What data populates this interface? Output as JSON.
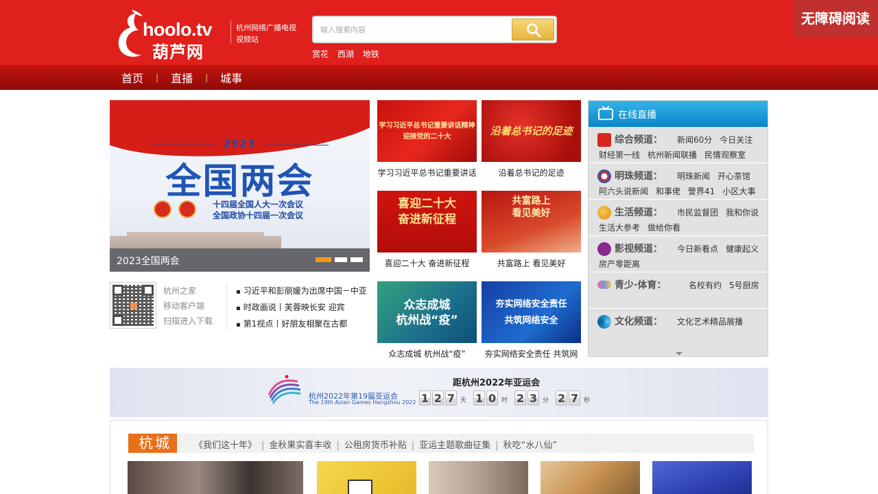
{
  "header": {
    "logo_main": "hoolo.tv",
    "logo_cn": "葫芦网",
    "logo_sub": "杭州网络广播电视视频站",
    "search_placeholder": "输入搜索内容",
    "hotwords": [
      "赏花",
      "西湖",
      "地铁"
    ],
    "accessibility_label": "无障碍阅读"
  },
  "nav": {
    "items": [
      "首页",
      "直播",
      "城事"
    ]
  },
  "slider": {
    "year": "2023",
    "title": "全国两会",
    "sub1": "十四届全国人大一次会议",
    "sub2": "全国政协十四届一次会议",
    "caption": "2023全国两会",
    "active_dot": 1,
    "dot_count": 3
  },
  "client": {
    "lines": [
      "杭州之家",
      "移动客户端",
      "扫描进入下载"
    ]
  },
  "news_list": [
    "习近平和彭丽媛为出席中国－中亚",
    "时政画说丨芙蓉映长安 迎宾",
    "第1视点丨好朋友相聚在古都"
  ],
  "thumbs": [
    {
      "caption": "学习习近平总书记重要讲话",
      "overlay": "学习习近平总书记重要讲话精神\n迎接党的二十大"
    },
    {
      "caption": "沿着总书记的足迹",
      "overlay": "沿着总书记的足迹"
    },
    {
      "caption": "喜迎二十大 奋进新征程",
      "overlay": "喜迎二十大\n奋进新征程"
    },
    {
      "caption": "共富路上 看见美好",
      "overlay": "共富路上\n看见美好"
    },
    {
      "caption": "众志成城 杭州战“疫”",
      "overlay": "众志成城\n杭州战“疫”"
    },
    {
      "caption": "夯实网络安全责任 共筑网",
      "overlay": "夯实网络安全责任\n共筑网络安全"
    }
  ],
  "live": {
    "title": "在线直播",
    "channels": [
      {
        "name": "综合频道：",
        "row1": [
          "新闻60分",
          "今日关注"
        ],
        "row2": [
          "财经第一线",
          "杭州新闻联播",
          "民情观察室"
        ],
        "color": "#d8261f"
      },
      {
        "name": "明珠频道：",
        "row1": [
          "明珠新闻",
          "开心茶馆"
        ],
        "row2": [
          "阿六头说新闻",
          "和事佬",
          "警界41",
          "小区大事"
        ],
        "color": "#1a63b8"
      },
      {
        "name": "生活频道：",
        "row1": [
          "市民监督团",
          "我和你说"
        ],
        "row2": [
          "生活大参考",
          "做给你看"
        ],
        "color": "#e9a21e"
      },
      {
        "name": "影视频道：",
        "row1": [
          "今日新看点",
          "健康起义"
        ],
        "row2": [
          "房产零距离"
        ],
        "color": "#8a2a8f"
      },
      {
        "name": "青少·体育：",
        "row1": [
          "名校有约",
          "5号厨房"
        ],
        "row2": [],
        "color": "#7b9ad8"
      },
      {
        "name": "文化频道：",
        "row1": [
          "文化艺术精品展播"
        ],
        "row2": [],
        "color": "#1f8fc9"
      }
    ]
  },
  "banner": {
    "games_cn": "杭州2022年第19届亚运会",
    "games_en": "The 19th Asian Games Hangzhou 2022",
    "countdown_title": "距杭州2022年亚运会",
    "days": "127",
    "hours": "10",
    "minutes": "23",
    "seconds": "27",
    "unit_day": "天",
    "unit_hour": "时",
    "unit_min": "分",
    "unit_sec": "秒"
  },
  "section": {
    "tag": "杭城",
    "links": [
      "《我们这十年》",
      "金秋果实喜丰收",
      "公租房货币补贴",
      "亚运主题歌曲征集",
      "秋吃“水八仙”"
    ]
  },
  "colors": {
    "header_red": "#e0201c",
    "nav_red": "#b01009",
    "live_blue": "#0a86c8",
    "accent_orange": "#e8701b"
  }
}
